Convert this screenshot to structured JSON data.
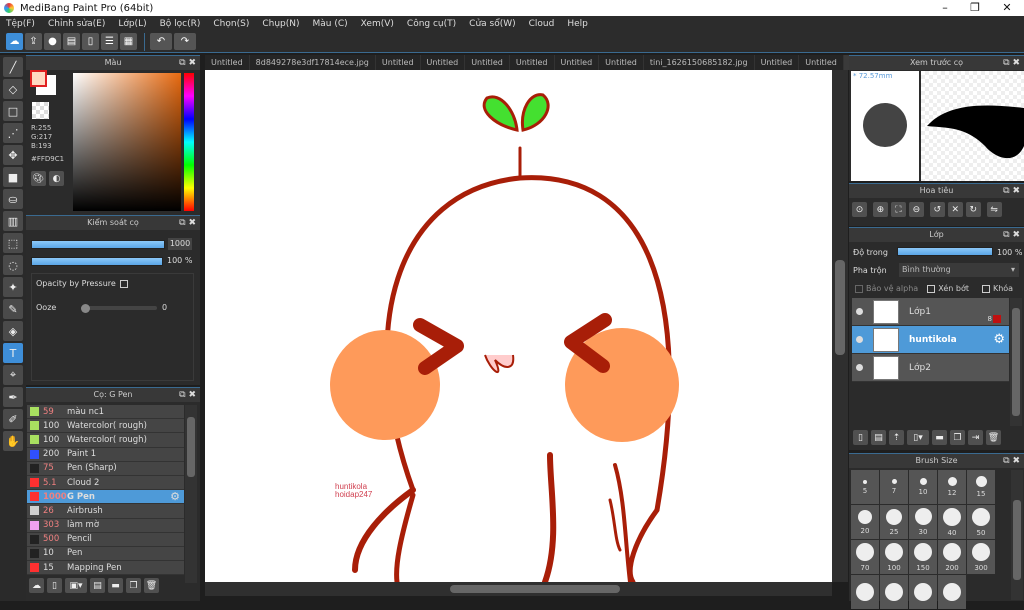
{
  "title": "MediBang Paint Pro (64bit)",
  "menu": [
    "Tệp(F)",
    "Chỉnh sửa(E)",
    "Lớp(L)",
    "Bộ lọc(R)",
    "Chọn(S)",
    "Chụp(N)",
    "Màu (C)",
    "Xem(V)",
    "Công cụ(T)",
    "Cửa sổ(W)",
    "Cloud",
    "Help"
  ],
  "tabs": [
    "Untitled",
    "8d849278e3df17814ece.jpg",
    "Untitled",
    "Untitled",
    "Untitled",
    "Untitled",
    "Untitled",
    "Untitled",
    "tini_1626150685182.jpg",
    "Untitled",
    "Untitled",
    "Untitled"
  ],
  "color_panel": {
    "title": "Màu",
    "r": "R:255",
    "g": "G:217",
    "b": "B:193",
    "hex": "#FFD9C1",
    "fg": "#FFD9C1"
  },
  "brush_control": {
    "title": "Kiểm soát cọ",
    "size": "1000",
    "opacity": "100 %",
    "opacity_by_pressure": "Opacity by Pressure",
    "ooze_label": "Ooze",
    "ooze_value": "0"
  },
  "brush_panel": {
    "title": "Cọ: G Pen",
    "items": [
      {
        "size": "59",
        "name": "màu nc1",
        "color": "#a8e060",
        "red": true
      },
      {
        "size": "100",
        "name": "Watercolor( rough)",
        "color": "#a8e060",
        "red": false
      },
      {
        "size": "100",
        "name": "Watercolor( rough)",
        "color": "#a8e060",
        "red": false
      },
      {
        "size": "200",
        "name": "Paint 1",
        "color": "#3050ff",
        "red": false
      },
      {
        "size": "75",
        "name": "Pen (Sharp)",
        "color": "#222222",
        "red": true
      },
      {
        "size": "5.1",
        "name": "Cloud 2",
        "color": "#ff3030",
        "red": true
      },
      {
        "size": "1000",
        "name": "G Pen",
        "color": "#ff3030",
        "red": true,
        "selected": true
      },
      {
        "size": "26",
        "name": "Airbrush",
        "color": "#d0d0d0",
        "red": true
      },
      {
        "size": "303",
        "name": "làm mờ",
        "color": "#f0a0f0",
        "red": true
      },
      {
        "size": "500",
        "name": "Pencil",
        "color": "#222222",
        "red": true
      },
      {
        "size": "10",
        "name": "Pen",
        "color": "#222222",
        "red": false
      },
      {
        "size": "15",
        "name": "Mapping Pen",
        "color": "#ff3030",
        "red": false
      }
    ]
  },
  "canvas_text": {
    "line1": "huntikola",
    "line2": "hoidap247"
  },
  "preview": {
    "title": "Xem trước cọ",
    "size": "* 72.57mm"
  },
  "navigator": {
    "title": "Hoa tiêu"
  },
  "layers": {
    "title": "Lớp",
    "opacity_label": "Độ trong",
    "opacity": "100 %",
    "blend_label": "Pha trộn",
    "blend": "Bình thường",
    "protect_alpha": "Bảo vệ alpha",
    "clipping": "Xén bớt",
    "lock": "Khóa",
    "items": [
      {
        "name": "Lớp1",
        "badge": "8"
      },
      {
        "name": "huntikola",
        "selected": true
      },
      {
        "name": "Lớp2"
      }
    ]
  },
  "brush_size": {
    "title": "Brush Size",
    "sizes": [
      "5",
      "7",
      "10",
      "12",
      "15",
      "20",
      "25",
      "30",
      "40",
      "50",
      "70",
      "100",
      "150",
      "200",
      "300",
      "",
      "",
      "",
      ""
    ]
  }
}
